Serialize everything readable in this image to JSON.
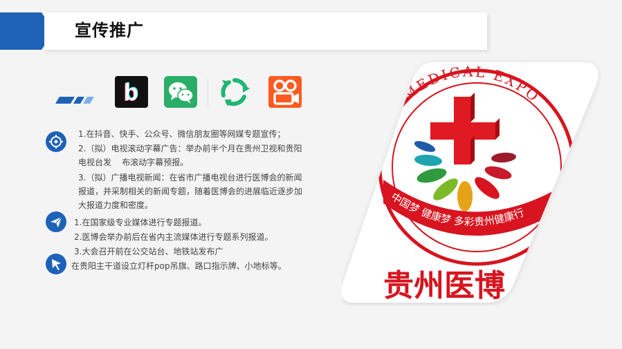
{
  "header": {
    "title": "宣传推广"
  },
  "social_logos": [
    "bilibili-style-logo",
    "wechat-logo",
    "recycle-logo",
    "kuaishou-style-logo"
  ],
  "section1": {
    "lines": [
      "1.在抖音、快手、公众号、微信朋友圈等网媒专题宣传；",
      "2.（拟）电视滚动字幕广告：举办前半个月在贵州卫视和贵阳",
      "电视台发    布滚动字幕预报。",
      "3.（拟）广播电视新闻：在省市广播电视台进行医博会的新闻",
      "报道，并采制相关的新闻专题，随着医博会的进展临近逐步加",
      "大报道力度和密度。"
    ]
  },
  "section2": {
    "lines": [
      "1.在国家级专业媒体进行专题报道。",
      "2.医博会举办前后在省内主流媒体进行专题系列报道。",
      "3.大会召开前在公交站台、地铁站发布广",
      "在贵阳主干道设立灯杆pop吊旗、路口指示牌、小地标等。"
    ]
  },
  "badge": {
    "arc_text": "MEDICAL EXPO",
    "ribbon_text": "中国梦  健康梦  多彩贵州健康行",
    "name_text": "贵州医博"
  },
  "colors": {
    "brand_blue": "#1e62b8",
    "light_blue": "#7fb0e8",
    "badge_red": "#d7141f"
  }
}
